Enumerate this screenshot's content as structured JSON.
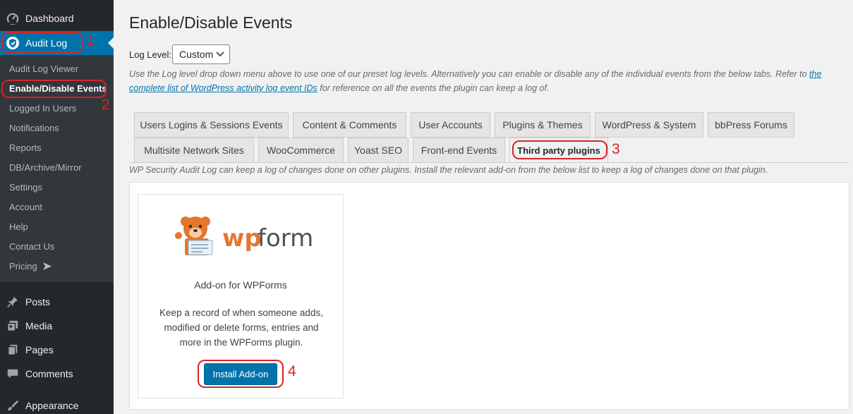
{
  "sidebar": {
    "top_items": [
      {
        "label": "Dashboard",
        "icon": "dashboard-icon"
      },
      {
        "label": "Audit Log",
        "icon": "shield-icon"
      }
    ],
    "submenu": [
      "Audit Log Viewer",
      "Enable/Disable Events",
      "Logged In Users",
      "Notifications",
      "Reports",
      "DB/Archive/Mirror",
      "Settings",
      "Account",
      "Help",
      "Contact Us",
      "Pricing"
    ],
    "bottom_items": [
      {
        "label": "Posts",
        "icon": "pin-icon"
      },
      {
        "label": "Media",
        "icon": "media-icon"
      },
      {
        "label": "Pages",
        "icon": "pages-icon"
      },
      {
        "label": "Comments",
        "icon": "comments-icon"
      },
      {
        "label": "Appearance",
        "icon": "brush-icon"
      }
    ]
  },
  "annotations": [
    "1",
    "2",
    "3",
    "4"
  ],
  "page": {
    "title": "Enable/Disable Events",
    "log_level_label": "Log Level:",
    "log_level_value": "Custom",
    "description_before": "Use the Log level drop down menu above to use one of our preset log levels. Alternatively you can enable or disable any of the individual events from the below tabs. Refer to",
    "description_link": "the complete list of WordPress activity log event IDs",
    "description_after": "for reference on all the events the plugin can keep a log of."
  },
  "tabs": {
    "row1": [
      "Users Logins & Sessions Events",
      "Content & Comments",
      "User Accounts",
      "Plugins & Themes",
      "WordPress & System",
      "bbPress Forums"
    ],
    "row2": [
      "Multisite Network Sites",
      "WooCommerce",
      "Yoast SEO",
      "Front-end Events",
      "Third party plugins"
    ],
    "active": "Third party plugins",
    "description": "WP Security Audit Log can keep a log of changes done on other plugins. Install the relevant add-on from the below list to keep a log of changes done on that plugin."
  },
  "addon": {
    "logo_text": "wpforms",
    "title": "Add-on for WPForms",
    "text": "Keep a record of when someone adds, modified or delete forms, entries and more in the WPForms plugin.",
    "button_label": "Install Add-on"
  },
  "colors": {
    "sidebar_bg": "#23282d",
    "submenu_bg": "#32373c",
    "accent": "#0073aa",
    "annotation": "#d9232a"
  }
}
